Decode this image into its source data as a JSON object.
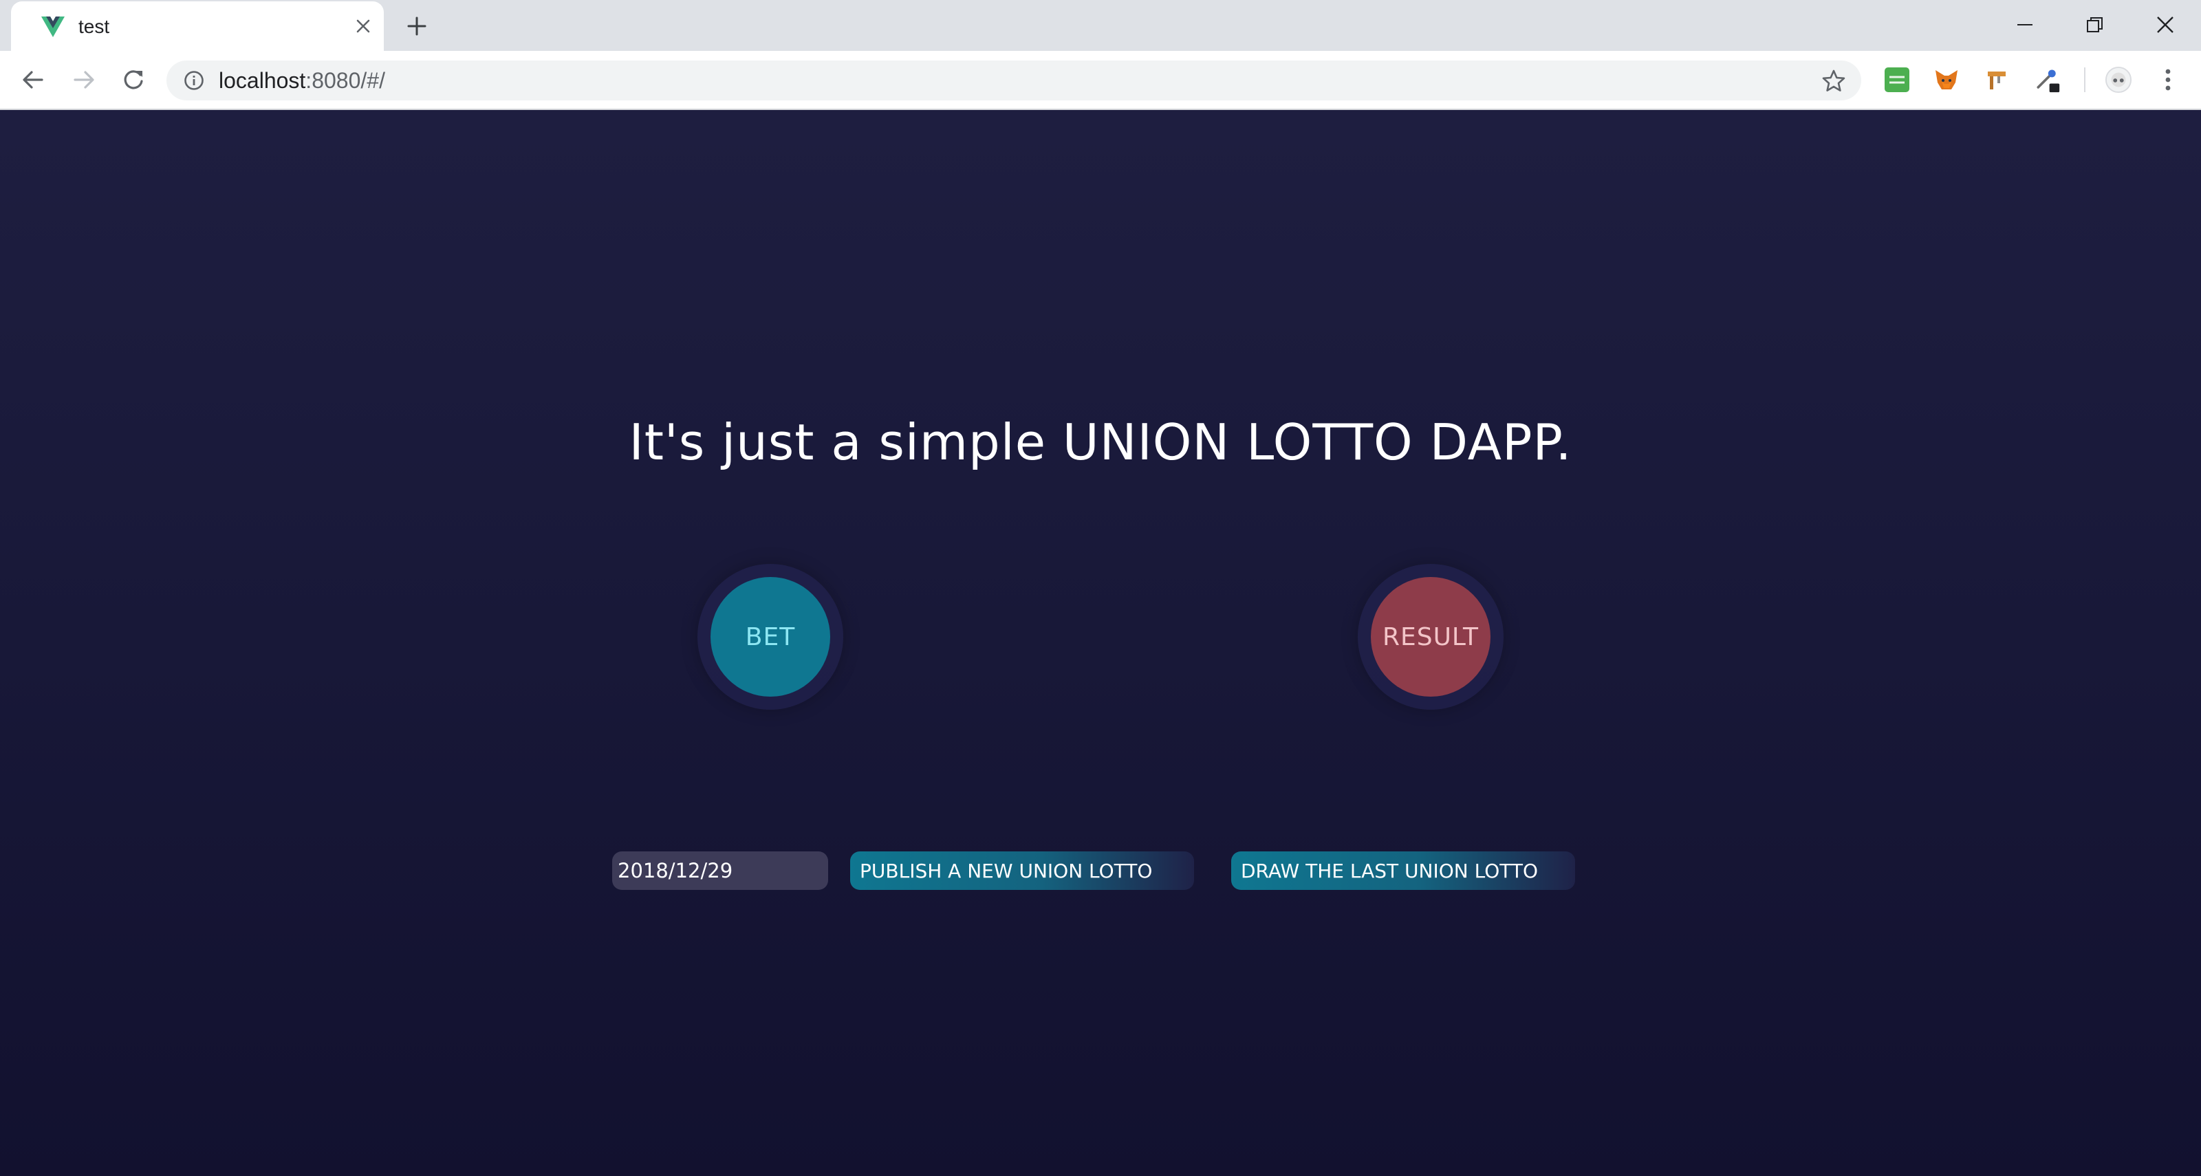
{
  "browser": {
    "tab": {
      "title": "test",
      "favicon": "vue-logo-icon"
    },
    "address": {
      "host": "localhost",
      "rest": ":8080/#/"
    },
    "extensions": [
      "cors-extension-icon",
      "metamask-fox-icon",
      "extension-icon",
      "eyedropper-extension-icon"
    ],
    "profile": "profile-avatar-icon"
  },
  "page": {
    "headline": "It's just a simple UNION LOTTO DAPP.",
    "bet_label": "BET",
    "result_label": "RESULT",
    "date_value": "2018/12/29",
    "publish_label": "PUBLISH A NEW UNION LOTTO",
    "draw_label": "DRAW THE LAST UNION LOTTO"
  },
  "colors": {
    "background_top": "#1e1e40",
    "background_bottom": "#12112f",
    "bet_button": "#0f7791",
    "result_button": "#8e3c4a",
    "action_button": "#0f7791"
  }
}
